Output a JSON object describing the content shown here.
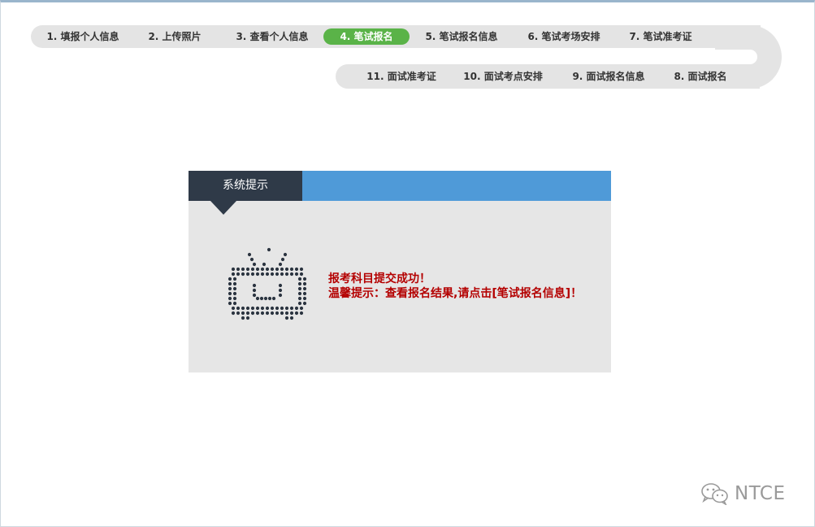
{
  "steps": {
    "s1": "1. 填报个人信息",
    "s2": "2. 上传照片",
    "s3": "3. 查看个人信息",
    "s4": "4. 笔试报名",
    "s5": "5. 笔试报名信息",
    "s6": "6. 笔试考场安排",
    "s7": "7. 笔试准考证",
    "s8": "8. 面试报名",
    "s9": "9. 面试报名信息",
    "s10": "10. 面试考点安排",
    "s11": "11. 面试准考证",
    "active": "4. 笔试报名",
    "active_color": "#5ab348"
  },
  "dialog": {
    "title": "系统提示",
    "icon": "tv-face-icon",
    "line1": "报考科目提交成功！",
    "line2": "温馨提示：查看报名结果,请点击[笔试报名信息]！",
    "message_color": "#b40000",
    "header_color": "#4f9ad8",
    "title_bg_color": "#2f3a48"
  },
  "watermark": {
    "icon": "wechat-icon",
    "text": "NTCE"
  }
}
